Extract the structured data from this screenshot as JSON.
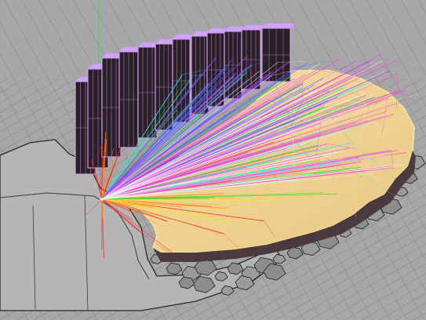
{
  "viewport": {
    "background": "#a7a7a7",
    "grid_color": "#8e8e8e",
    "axis_y_color": "#27e043",
    "axis_x_color": "#d23a3a"
  },
  "scene": {
    "floor_slab_fill": "#b5b5b5",
    "floor_slab_outline": "#2a2a2a",
    "audience_surface_fill": "#f3d7a0",
    "audience_surface_edge": "#f6e79c",
    "stage_tower_fill": "#2a1f24",
    "stage_tower_edge": "#c99cf0",
    "terrace_fill": "#4a3a3e",
    "ray_origin_color": "#ffffff"
  },
  "ray_bundles": [
    {
      "name": "red",
      "color": "#ff1e1e",
      "count": 34
    },
    {
      "name": "orange",
      "color": "#ff8a1e",
      "count": 30
    },
    {
      "name": "yellow",
      "color": "#f5e33a",
      "count": 26
    },
    {
      "name": "green",
      "color": "#2fdc2f",
      "count": 52
    },
    {
      "name": "cyan",
      "color": "#26f0f0",
      "count": 40
    },
    {
      "name": "blue",
      "color": "#2f6bff",
      "count": 36
    },
    {
      "name": "violet",
      "color": "#c53bff",
      "count": 34
    },
    {
      "name": "magenta",
      "color": "#ff3bd8",
      "count": 48
    },
    {
      "name": "white",
      "color": "#ececec",
      "count": 40
    }
  ]
}
